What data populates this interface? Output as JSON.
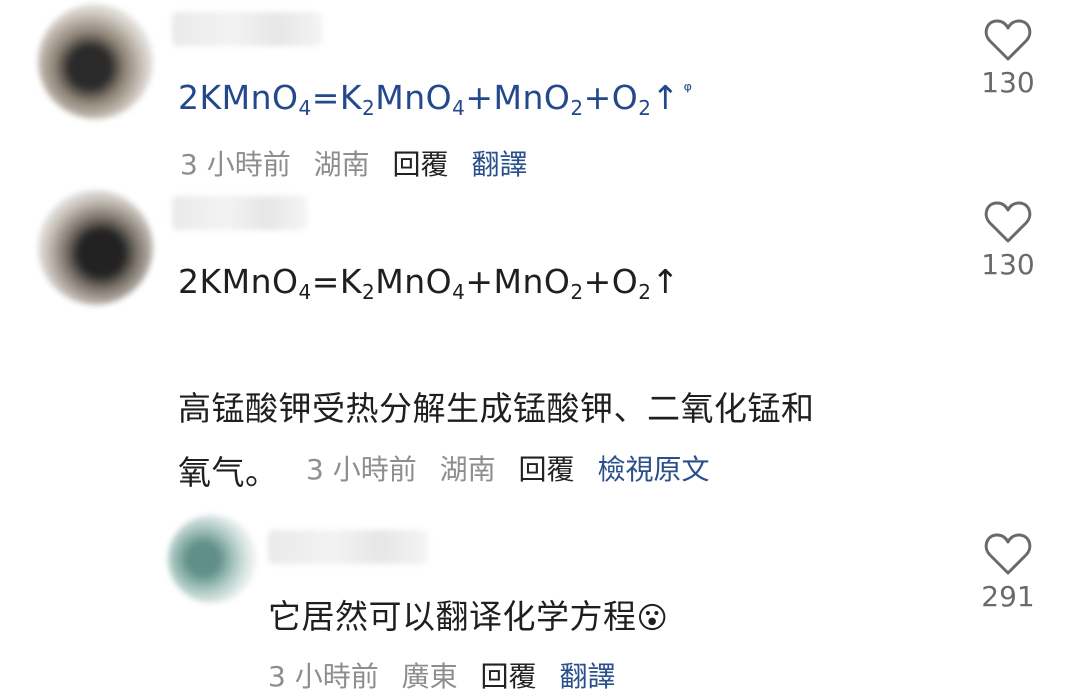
{
  "comments": [
    {
      "equation": [
        "2KMnO",
        "4",
        "=K",
        "2",
        "MnO",
        "4",
        "+MnO",
        "2",
        "+O",
        "2",
        "↑"
      ],
      "search_glyph": "ᵠ",
      "time": "3 小時前",
      "location": "湖南",
      "reply_label": "回覆",
      "translate_label": "翻譯",
      "likes": "130"
    },
    {
      "equation": [
        "2KMnO",
        "4",
        "=K",
        "2",
        "MnO",
        "4",
        "+MnO",
        "2",
        "+O",
        "2",
        "↑"
      ],
      "translation_line1": "高锰酸钾受热分解生成锰酸钾、二氧化锰和",
      "translation_line2": "氧气。",
      "time": "3 小時前",
      "location": "湖南",
      "reply_label": "回覆",
      "view_original_label": "檢視原文",
      "likes": "130"
    },
    {
      "text": "它居然可以翻译化学方程",
      "emoji": "😮",
      "time": "3 小時前",
      "location": "廣東",
      "reply_label": "回覆",
      "translate_label": "翻譯",
      "likes": "291"
    }
  ],
  "colors": {
    "link_blue": "#24488c",
    "meta_gray": "#8e8e8e",
    "heart_gray": "#6a6a6a"
  },
  "icons": {
    "like": "heart-icon",
    "avatar": "avatar-image"
  }
}
